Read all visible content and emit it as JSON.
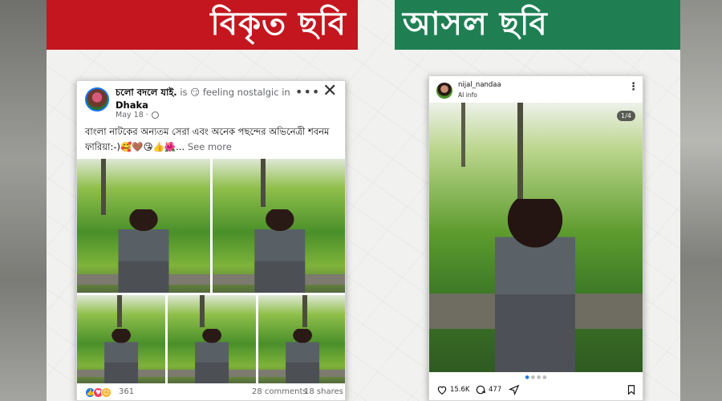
{
  "banners": {
    "left_title": "বিকৃত ছবি",
    "right_title": "আসল ছবি",
    "left_color": "#c4161e",
    "right_color": "#1f7f53"
  },
  "facebook_post": {
    "author": "চলো বদলে যাই.",
    "activity": " is 😏 feeling nostalgic in ",
    "location": "Dhaka",
    "date": "May 18 ·",
    "caption": "বাংলা নাটকের অন্যতম সেরা এবং অনেক পছন্দের অভিনেত্রী শবনম ফারিয়া:-)🥰🤎😘👍🌺...",
    "see_more": "See more",
    "more_menu": "•••",
    "close": "✕",
    "reaction_count": "361",
    "comments": "28 comments",
    "shares": "18 shares",
    "photo_count": 5
  },
  "instagram_post": {
    "username": "nijal_nandaa",
    "subtitle": "AI info",
    "menu": "⋮",
    "page_indicator": "1/4",
    "likes": "15.6K",
    "comments": "477",
    "carousel_dots": 4,
    "active_dot": 1
  }
}
